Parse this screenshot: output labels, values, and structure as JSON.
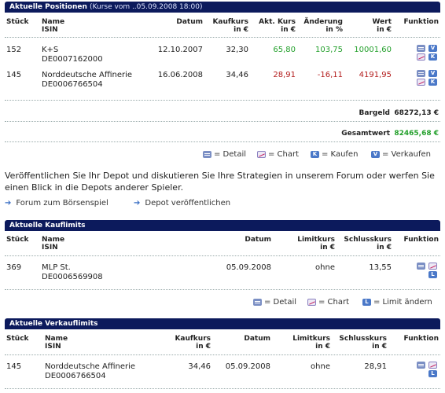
{
  "positions": {
    "title": "Aktuelle Positionen",
    "note": "(Kurse vom ..05.09.2008 18:00)",
    "columns": {
      "stueck": "Stück",
      "name": "Name",
      "isin": "ISIN",
      "datum": "Datum",
      "kaufkurs": "Kaufkurs",
      "kaufkurs_unit": "in €",
      "akt_kurs": "Akt. Kurs",
      "akt_kurs_unit": "in €",
      "aenderung": "Änderung",
      "aenderung_unit": "in %",
      "wert": "Wert",
      "wert_unit": "in €",
      "funktion": "Funktion"
    },
    "rows": [
      {
        "stueck": "152",
        "name": "K+S",
        "isin": "DE0007162000",
        "datum": "12.10.2007",
        "kaufkurs": "32,30",
        "akt_kurs": "65,80",
        "aenderung": "103,75",
        "wert": "10001,60",
        "trend": "up"
      },
      {
        "stueck": "145",
        "name": "Norddeutsche Affinerie",
        "isin": "DE0006766504",
        "datum": "16.06.2008",
        "kaufkurs": "34,46",
        "akt_kurs": "28,91",
        "aenderung": "-16,11",
        "wert": "4191,95",
        "trend": "down"
      }
    ],
    "bargeld_label": "Bargeld",
    "bargeld_value": "68272,13 €",
    "gesamtwert_label": "Gesamtwert",
    "gesamtwert_value": "82465,68 €",
    "legend": {
      "detail": "= Detail",
      "chart": "= Chart",
      "kaufen": "= Kaufen",
      "verkaufen": "= Verkaufen"
    }
  },
  "paragraph": "Veröffentlichen Sie Ihr Depot und diskutieren Sie Ihre Strategien in unserem Forum oder werfen Sie einen Blick in die Depots anderer Spieler.",
  "links": {
    "forum": "Forum zum Börsenspiel",
    "publish": "Depot veröffentlichen"
  },
  "kauflimits": {
    "title": "Aktuelle Kauflimits",
    "columns": {
      "stueck": "Stück",
      "name": "Name",
      "isin": "ISIN",
      "datum": "Datum",
      "limitkurs": "Limitkurs",
      "limitkurs_unit": "in €",
      "schlusskurs": "Schlusskurs",
      "schlusskurs_unit": "in €",
      "funktion": "Funktion"
    },
    "rows": [
      {
        "stueck": "369",
        "name": "MLP St.",
        "isin": "DE0006569908",
        "datum": "05.09.2008",
        "limitkurs": "ohne",
        "schlusskurs": "13,55"
      }
    ],
    "legend": {
      "detail": "= Detail",
      "chart": "= Chart",
      "limit": "= Limit ändern"
    }
  },
  "verkauflimits": {
    "title": "Aktuelle Verkauflimits",
    "columns": {
      "stueck": "Stück",
      "name": "Name",
      "isin": "ISIN",
      "kaufkurs": "Kaufkurs",
      "kaufkurs_unit": "in €",
      "datum": "Datum",
      "limitkurs": "Limitkurs",
      "limitkurs_unit": "in €",
      "schlusskurs": "Schlusskurs",
      "schlusskurs_unit": "in €",
      "funktion": "Funktion"
    },
    "rows": [
      {
        "stueck": "145",
        "name": "Norddeutsche Affinerie",
        "isin": "DE0006766504",
        "kaufkurs": "34,46",
        "datum": "05.09.2008",
        "limitkurs": "ohne",
        "schlusskurs": "28,91"
      }
    ]
  },
  "icons": {
    "detail": "list-icon",
    "chart": "chart-icon",
    "buy": "K",
    "sell": "V",
    "limit": "L"
  },
  "colors": {
    "header_bg": "#0c1a5c",
    "positive": "#24a02c",
    "negative": "#b31c1c",
    "link_arrow": "#3a6fc4"
  }
}
